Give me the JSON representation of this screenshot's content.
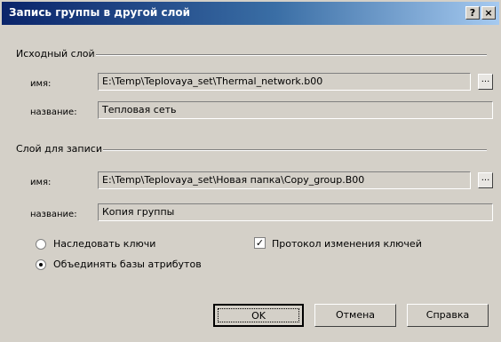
{
  "window": {
    "title": "Запись группы в другой слой",
    "help_label": "?",
    "close_label": "×"
  },
  "source_layer": {
    "heading": "Исходный слой",
    "name_label": "имя:",
    "name_value": "E:\\Temp\\Teplovaya_set\\Thermal_network.b00",
    "title_label": "название:",
    "title_value": "Тепловая сеть",
    "browse_label": "..."
  },
  "target_layer": {
    "heading": "Слой для записи",
    "name_label": "имя:",
    "name_value": "E:\\Temp\\Teplovaya_set\\Новая папка\\Copy_group.B00",
    "title_label": "название:",
    "title_value": "Копия группы",
    "browse_label": "..."
  },
  "options": {
    "inherit_keys": {
      "label": "Наследовать ключи",
      "selected": false
    },
    "merge_attr_db": {
      "label": "Объединять базы атрибутов",
      "selected": true
    },
    "key_change_log": {
      "label": "Протокол изменения ключей",
      "checked": true,
      "check_mark": "✓"
    }
  },
  "buttons": {
    "ok": "OK",
    "cancel": "Отмена",
    "help": "Справка"
  }
}
